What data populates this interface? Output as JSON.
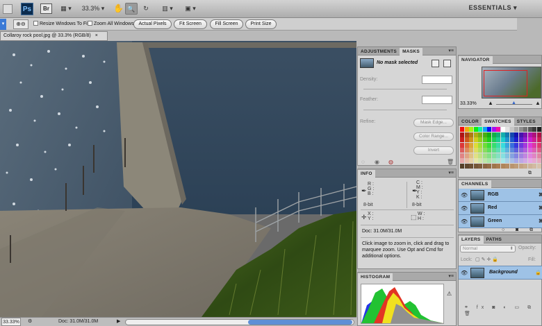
{
  "app_bar": {
    "zoom": "33.3%",
    "logo_ps": "Ps",
    "logo_br": "Br",
    "workspace": "ESSENTIALS"
  },
  "options_bar": {
    "resize_windows": "Resize Windows To Fit",
    "zoom_all_windows": "Zoom All Windows",
    "buttons": [
      "Actual Pixels",
      "Fit Screen",
      "Fill Screen",
      "Print Size"
    ]
  },
  "document": {
    "tab_title": "Collaroy rock pool.jpg @ 33.3% (RGB/8)",
    "close": "×",
    "status_zoom": "33.33%",
    "status_doc": "Doc: 31.0M/31.0M"
  },
  "adjustments_panel": {
    "tabs": [
      "ADJUSTMENTS",
      "MASKS"
    ],
    "mask_status": "No mask selected",
    "density_label": "Density:",
    "feather_label": "Feather:",
    "refine_label": "Refine:",
    "buttons": [
      "Mask Edge...",
      "Color Range...",
      "Invert"
    ]
  },
  "info_panel": {
    "tab": "INFO",
    "left_channels": [
      "R :",
      "G :",
      "B :"
    ],
    "right_channels": [
      "C :",
      "M :",
      "Y :",
      "K :"
    ],
    "left_bits": "8-bit",
    "right_bits": "8-bit",
    "xy": [
      "X :",
      "Y :"
    ],
    "wh": [
      "W :",
      "H :"
    ],
    "doc": "Doc: 31.0M/31.0M",
    "hint": "Click image to zoom in, click and drag to marquee zoom. Use Opt and Cmd for additional options."
  },
  "histogram_panel": {
    "tab": "HISTOGRAM",
    "warning": "⚠"
  },
  "navigator_panel": {
    "tab": "NAVIGATOR",
    "zoom": "33.33%"
  },
  "color_panel": {
    "tabs": [
      "COLOR",
      "SWATCHES",
      "STYLES"
    ]
  },
  "channels_panel": {
    "tab": "CHANNELS",
    "channels": [
      {
        "name": "RGB",
        "key": "⌘"
      },
      {
        "name": "Red",
        "key": "⌘"
      },
      {
        "name": "Green",
        "key": "⌘"
      }
    ]
  },
  "layers_panel": {
    "tabs": [
      "LAYERS",
      "PATHS"
    ],
    "blend_mode": "Normal",
    "opacity_label": "Opacity:",
    "lock_label": "Lock:",
    "fill_label": "Fill:",
    "layer_name": "Background"
  }
}
